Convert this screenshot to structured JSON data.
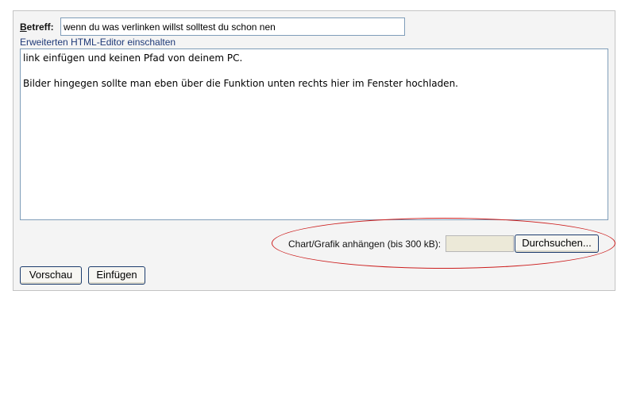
{
  "form": {
    "subject_label_underlined": "B",
    "subject_label_rest": "etreff:",
    "subject_value": "wenn du was verlinken willst solltest du schon nen",
    "html_editor_link": "Erweiterten HTML-Editor einschalten",
    "body_lines": [
      "link einfügen und keinen Pfad von deinem PC.",
      "",
      "Bilder hingegen sollte man eben über die Funktion unten rechts hier im Fenster hochladen."
    ],
    "attach_label": "Chart/Grafik anhängen (bis 300 kB):",
    "browse_label": "Durchsuchen...",
    "preview_label": "Vorschau",
    "insert_label": "Einfügen"
  },
  "colors": {
    "panel_bg": "#f4f4f4",
    "link": "#1f3a78",
    "highlight_ellipse": "#cc1e1e",
    "input_border": "#7f9db9"
  }
}
